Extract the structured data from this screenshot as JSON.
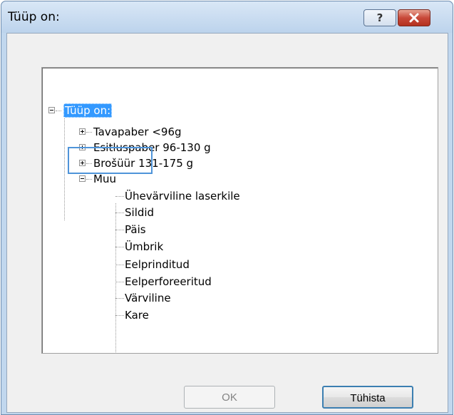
{
  "window": {
    "title": "Tüüp on:"
  },
  "title_buttons": {
    "help_icon": "?",
    "close_icon": "close-x"
  },
  "tree": {
    "root": {
      "label": "Tüüp on:",
      "expanded": true,
      "selected": true
    },
    "children": [
      {
        "label": "Tavapaber <96g",
        "expanded": false
      },
      {
        "label": "Esitluspaber 96-130 g",
        "expanded": false
      },
      {
        "label": "Brošüür 131-175 g",
        "expanded": false
      },
      {
        "label": "Muu",
        "expanded": true
      }
    ],
    "muu_children": [
      "Ühevärviline laserkile",
      "Sildid",
      "Päis",
      "Ümbrik",
      "Eelprinditud",
      "Eelperforeeritud",
      "Värviline",
      "Kare"
    ]
  },
  "buttons": {
    "ok": "OK",
    "cancel": "Tühista"
  },
  "colors": {
    "selection": "#3399ff",
    "focus": "#4f94d9",
    "titlebar": "#c1d7ee"
  }
}
